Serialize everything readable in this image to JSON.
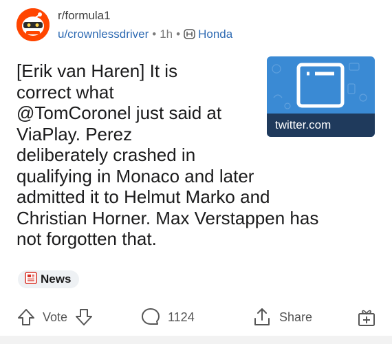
{
  "post": {
    "subreddit": "r/formula1",
    "author": "u/crownlessdriver",
    "age": "1h",
    "flair": "Honda",
    "title_lines": [
      "[Erik van Haren] It is",
      "correct what",
      "@TomCoronel just said at",
      "ViaPlay. Perez",
      "deliberately crashed in",
      "qualifying in Monaco and later",
      "admitted it to Helmut Marko and",
      "Christian Horner. Max Verstappen has",
      "not forgotten that."
    ],
    "link_domain": "twitter.com",
    "tag": "News"
  },
  "actions": {
    "vote_label": "Vote",
    "comments_count": "1124",
    "share_label": "Share"
  },
  "colors": {
    "link": "#2f6bb3",
    "avatar_bg": "#ff4500",
    "thumb_bg": "#3a8ad4",
    "thumb_bar": "#1f3a5c"
  }
}
